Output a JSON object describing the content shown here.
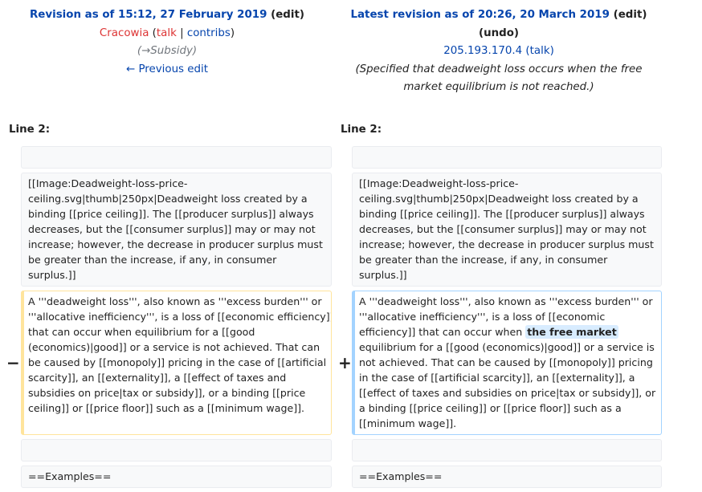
{
  "left_header": {
    "title": "Revision as of 15:12, 27 February 2019",
    "edit": "(edit)",
    "user": "Cracowia",
    "talk": "talk",
    "contribs": "contribs",
    "summary": "(→Subsidy)",
    "prev": "← Previous edit"
  },
  "right_header": {
    "title": "Latest revision as of 20:26, 20 March 2019",
    "edit": "(edit)",
    "undo": "(undo)",
    "user": "205.193.170.4",
    "talk": "(talk)",
    "summary_lines": [
      "(Specified that deadweight loss occurs when the free",
      "market equilibrium is not reached.)"
    ]
  },
  "line_label": "Line 2:",
  "context_lines": [
    "[[Image:Deadweight-loss-price-",
    "ceiling.svg|thumb|250px|Deadweight loss created by a",
    "binding [[price ceiling]]. The [[producer surplus]] always",
    "decreases, but the [[consumer surplus]] may or may not",
    "increase; however, the decrease in producer surplus must",
    "be greater than the increase, if any, in consumer",
    "surplus.]]"
  ],
  "deleted": {
    "marker": "−",
    "lines": [
      "A '''deadweight loss''', also known as '''excess burden''' or",
      "'''allocative inefficiency''', is a loss of [[economic efficiency]]",
      "that can occur when equilibrium for a [[good",
      "(economics)|good]] or a service is not achieved. That can",
      "be caused by [[monopoly]] pricing in the case of [[artificial",
      "scarcity]], an [[externality]], a [[effect of taxes and",
      "subsidies on price|tax or subsidy]], or a binding [[price",
      "ceiling]] or [[price floor]] such as a [[minimum wage]]."
    ]
  },
  "added": {
    "marker": "+",
    "lines": [
      "A '''deadweight loss''', also known as '''excess burden''' or",
      "'''allocative inefficiency''', is a loss of [[economic",
      "efficiency]] that can occur when",
      "equilibrium for a [[good (economics)|good]] or a service is",
      "not achieved. That can be caused by [[monopoly]] pricing",
      "in the case of [[artificial scarcity]], an [[externality]], a",
      "[[effect of taxes and subsidies on price|tax or subsidy]], or",
      "a binding [[price ceiling]] or [[price floor]] such as a",
      "[[minimum wage]]."
    ],
    "inserted": "the free market"
  },
  "examples": "==Examples=="
}
